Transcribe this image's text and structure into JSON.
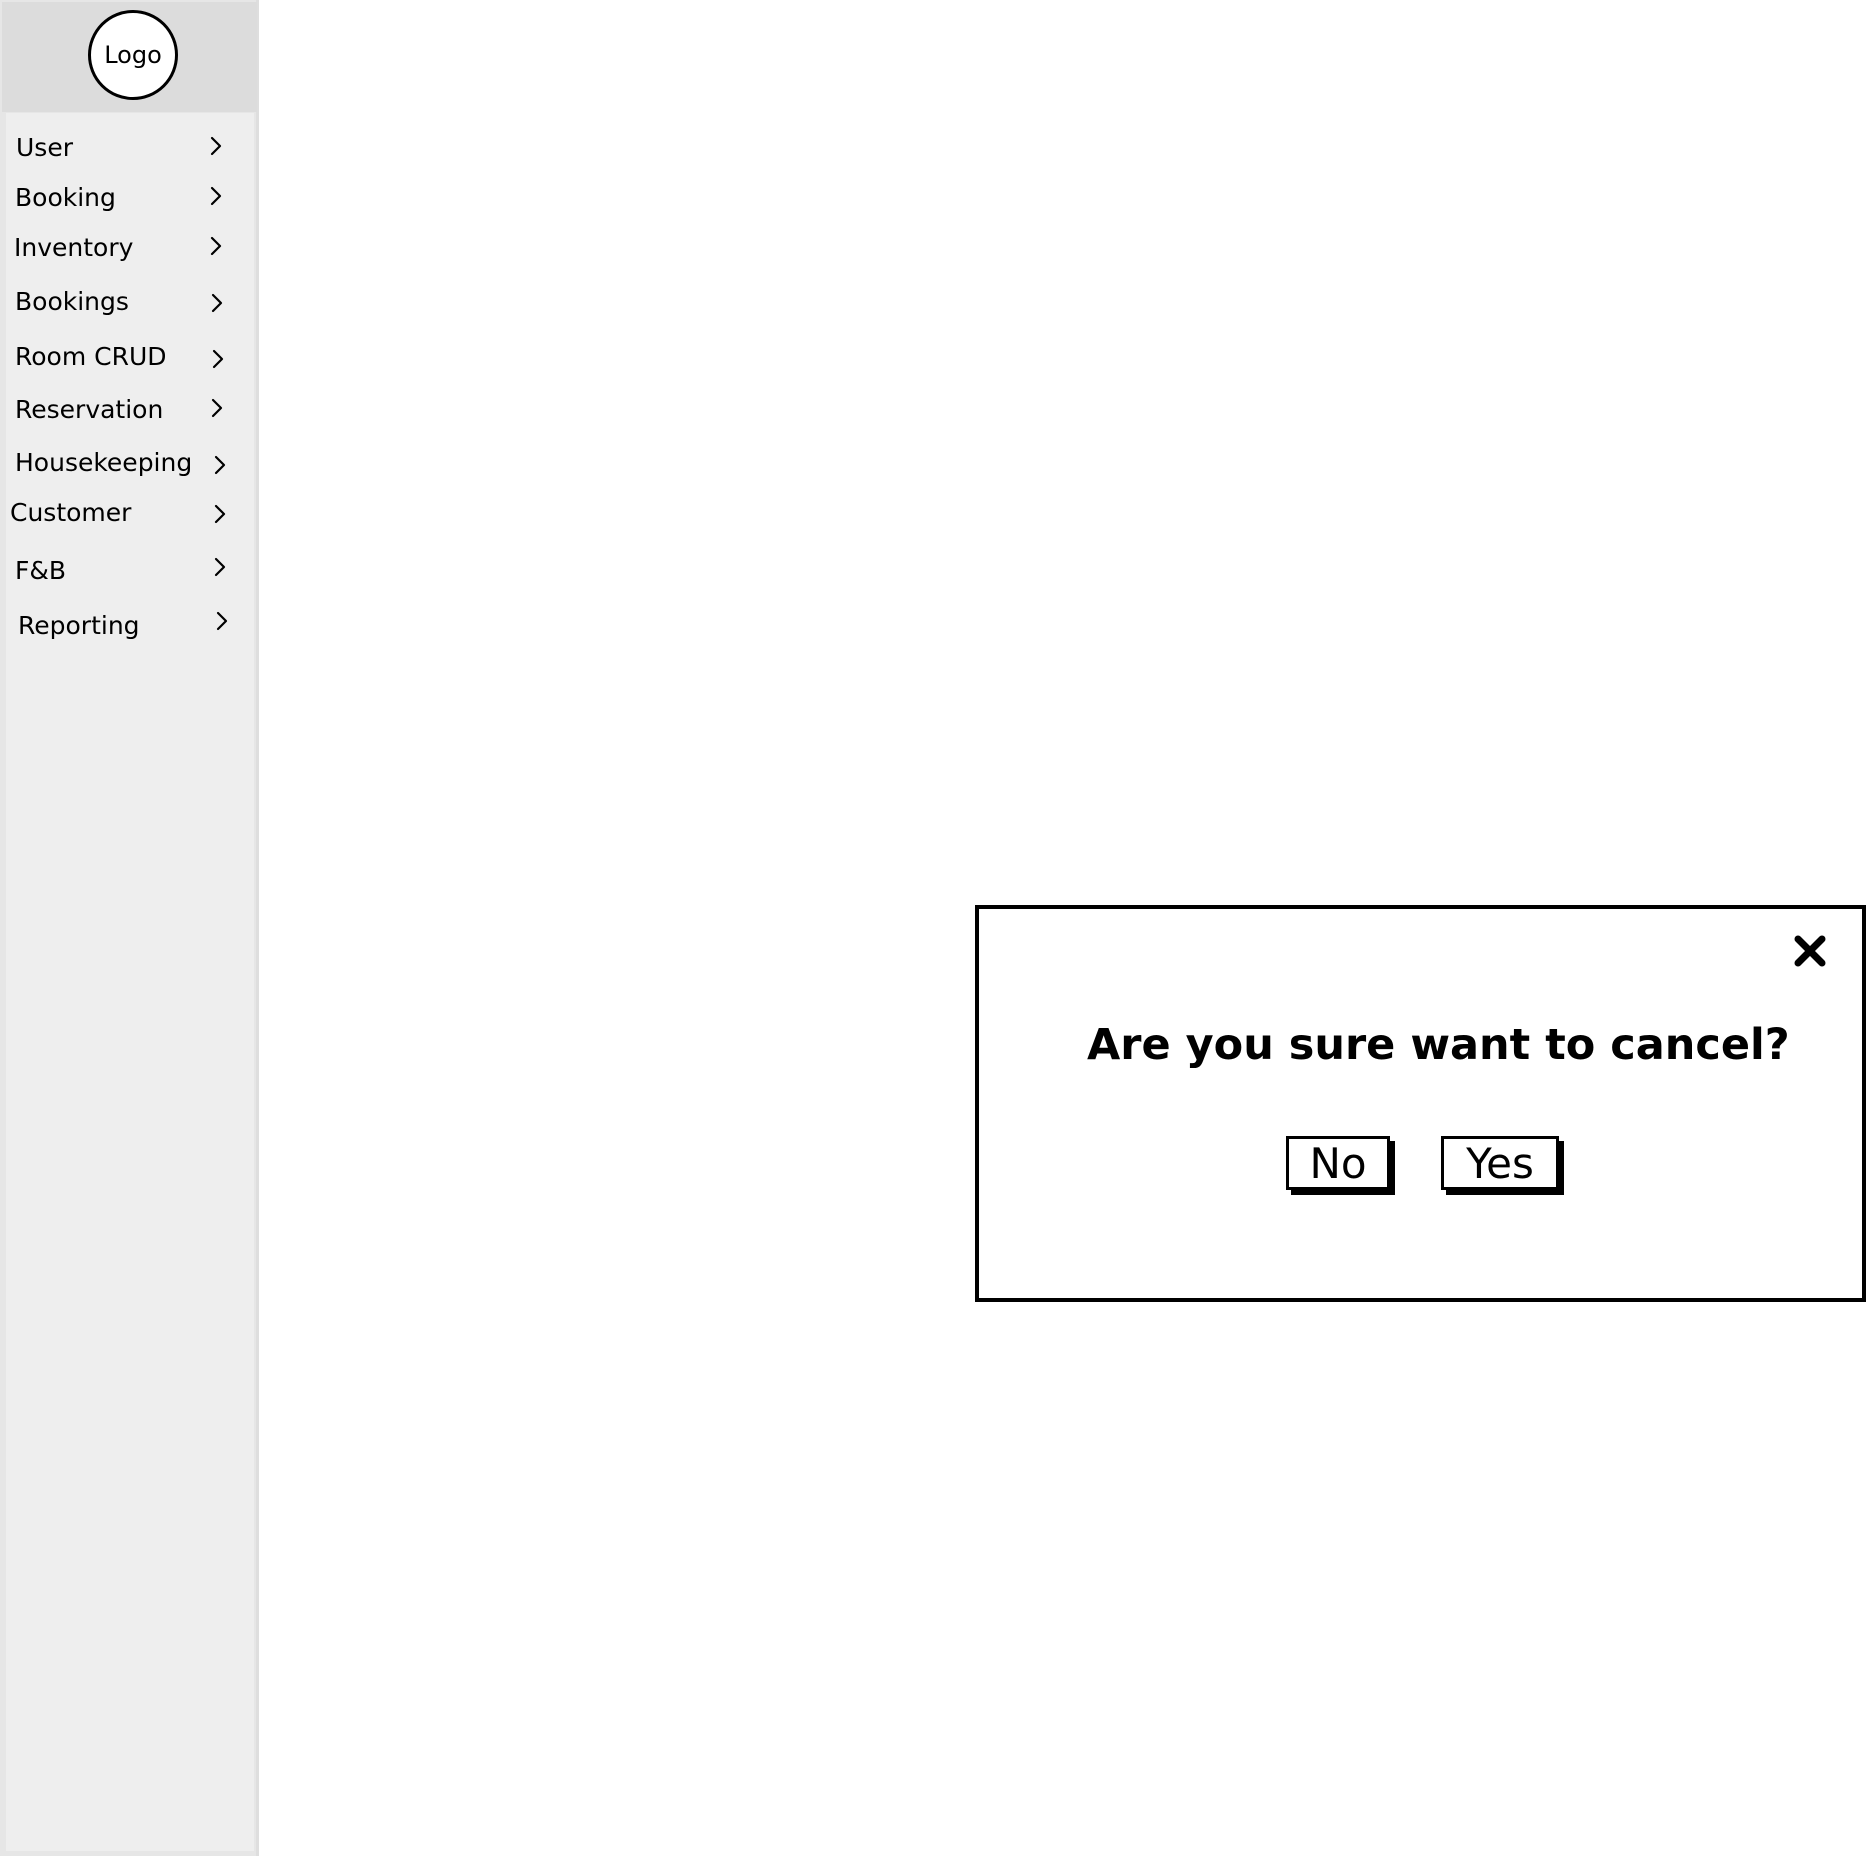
{
  "sidebar": {
    "logo_text": "Logo",
    "items": [
      {
        "label": "User"
      },
      {
        "label": "Booking"
      },
      {
        "label": "Inventory"
      },
      {
        "label": "Bookings"
      },
      {
        "label": "Room CRUD"
      },
      {
        "label": "Reservation"
      },
      {
        "label": "Housekeeping"
      },
      {
        "label": "Customer"
      },
      {
        "label": "F&B"
      },
      {
        "label": "Reporting"
      }
    ],
    "chevron_icon": "chevron-right-icon"
  },
  "dialog": {
    "message": "Are you sure want to cancel?",
    "no_label": "No",
    "yes_label": "Yes",
    "close_icon": "close-icon"
  },
  "colors": {
    "sidebar_bg": "#eeeeee",
    "sidebar_header_bg": "#dcdcdc",
    "border": "#000000"
  }
}
